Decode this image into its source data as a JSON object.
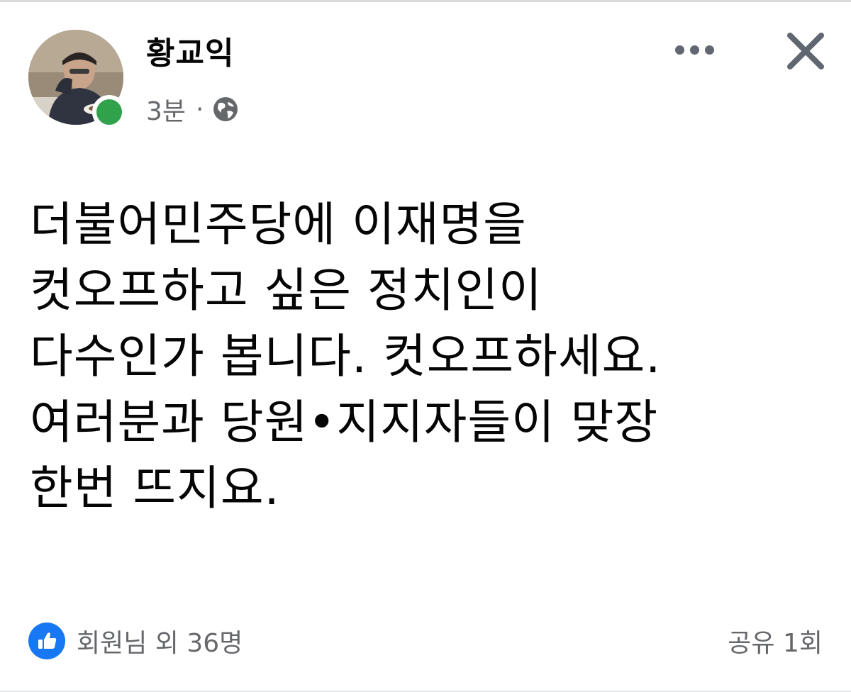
{
  "post": {
    "author": {
      "name": "황교익"
    },
    "meta": {
      "time": "3분",
      "separator": "·",
      "privacy_icon": "globe-icon"
    },
    "lines": [
      "더불어민주당에 이재명을",
      "컷오프하고 싶은 정치인이",
      "다수인가 봅니다. 컷오프하세요.",
      "여러분과 당원•지지자들이 맞장",
      "한번 뜨지요."
    ]
  },
  "header_actions": {
    "more_icon": "more-horizontal-icon",
    "close_icon": "close-icon"
  },
  "footer": {
    "reaction_icon": "like-icon",
    "reactions_text": "회원님 외 36명",
    "share_text": "공유 1회"
  },
  "colors": {
    "accent": "#1877f2",
    "online": "#31a24c",
    "secondary_text": "#65676b",
    "primary_text": "#050505"
  }
}
